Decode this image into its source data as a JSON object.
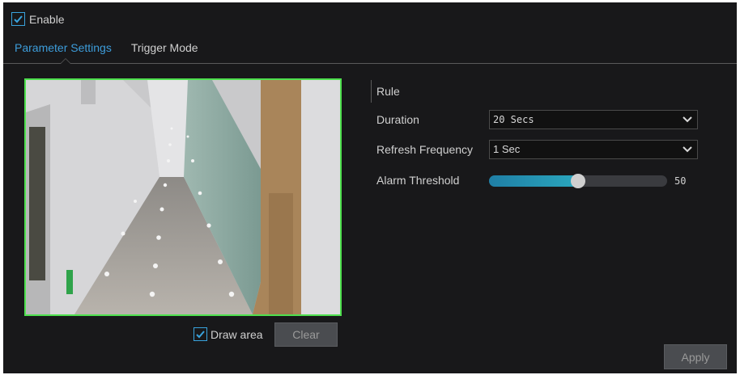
{
  "enable": {
    "label": "Enable",
    "checked": true
  },
  "tabs": [
    {
      "label": "Parameter Settings",
      "active": true
    },
    {
      "label": "Trigger Mode",
      "active": false
    }
  ],
  "preview": {
    "draw_area": {
      "label": "Draw area",
      "checked": true
    },
    "clear_label": "Clear"
  },
  "rule": {
    "title": "Rule",
    "duration": {
      "label": "Duration",
      "value": "20 Secs"
    },
    "refresh": {
      "label": "Refresh Frequency",
      "value": "1 Sec"
    },
    "threshold": {
      "label": "Alarm Threshold",
      "value": "50",
      "fraction": 0.5
    }
  },
  "apply_label": "Apply",
  "colors": {
    "accent": "#3d9ddb",
    "area_border": "#4ee04e",
    "slider": "#2aa6bd"
  }
}
